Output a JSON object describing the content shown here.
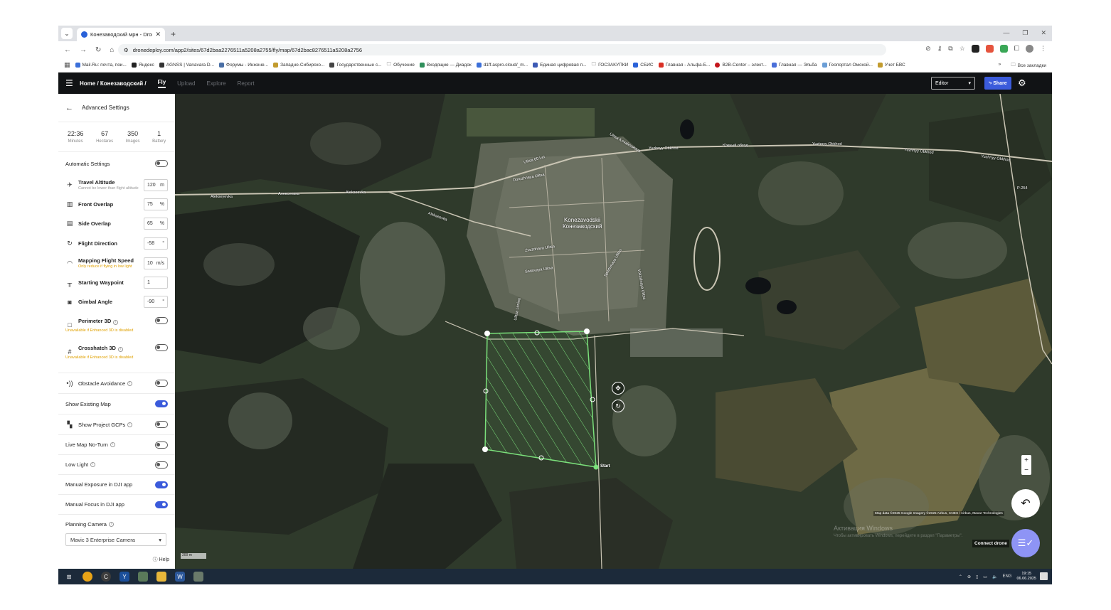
{
  "browser": {
    "tab_title": "Конезаводский мрн - DroneDeploy",
    "url": "dronedeploy.com/app2/sites/67d2baa2276511a5208a2755/fly/map/67d2bac8276511a5208a2756",
    "bookmarks": [
      "Mail.Ru: почта, пои...",
      "Яндекс",
      "AGNSS | Vanavara D...",
      "Форумы - Инжене...",
      "Западно-Сибирско...",
      "Государственные с...",
      "Обучение",
      "Входящие — Диадок",
      "d1ff.aspro.cloud/_m...",
      "Единая цифровая п...",
      "ГОСЗАКУПКИ",
      "СБИС",
      "Главная - Альфа-Б...",
      "B2B-Center – элект...",
      "Главная — Эльба",
      "Геопортал Омской...",
      "Учет БВС"
    ],
    "bookmarks_more": "»",
    "all_bookmarks": "Все закладки"
  },
  "appbar": {
    "breadcrumb": "Home / Конезаводский /",
    "tabs": [
      "Fly",
      "Upload",
      "Explore",
      "Report"
    ],
    "role": "Editor",
    "share_label": "Share"
  },
  "sidebar": {
    "title": "Advanced Settings",
    "stats": [
      {
        "value": "22:36",
        "label": "Minutes"
      },
      {
        "value": "67",
        "label": "Hectares"
      },
      {
        "value": "350",
        "label": "Images"
      },
      {
        "value": "1",
        "label": "Battery"
      }
    ],
    "automatic_settings": "Automatic Settings",
    "travel_altitude": {
      "label": "Travel Altitude",
      "hint": "Cannot be lower than flight altitude",
      "value": "120",
      "unit": "m"
    },
    "front_overlap": {
      "label": "Front Overlap",
      "value": "75",
      "unit": "%"
    },
    "side_overlap": {
      "label": "Side Overlap",
      "value": "65",
      "unit": "%"
    },
    "flight_direction": {
      "label": "Flight Direction",
      "value": "-58",
      "unit": "°"
    },
    "mapping_speed": {
      "label": "Mapping Flight Speed",
      "hint": "Only reduce if flying in low light",
      "value": "10",
      "unit": "m/s"
    },
    "starting_waypoint": {
      "label": "Starting Waypoint",
      "value": "1"
    },
    "gimbal_angle": {
      "label": "Gimbal Angle",
      "value": "-90",
      "unit": "°"
    },
    "perimeter_3d": {
      "label": "Perimeter 3D",
      "warn": "Unavailable if Enhanced 3D is disabled"
    },
    "crosshatch_3d": {
      "label": "Crosshatch 3D",
      "warn": "Unavailable if Enhanced 3D is disabled"
    },
    "obstacle_avoidance": "Obstacle Avoidance",
    "show_existing_map": "Show Existing Map",
    "show_project_gcps": "Show Project GCPs",
    "live_map_no_turn": "Live Map No-Turn",
    "low_light": "Low Light",
    "manual_exposure": "Manual Exposure in DJI app",
    "manual_focus": "Manual Focus in DJI app",
    "planning_camera": "Planning Camera",
    "camera_value": "Mavic 3 Enterprise Camera",
    "help": "Help"
  },
  "map": {
    "town_latin": "Konezavodskii",
    "town_cyrillic": "Конезаводский",
    "labels": [
      "Alekseyevka",
      "Алексеевка",
      "Alekseevka",
      "Alekseevka",
      "Yuzhnyy Obkhod",
      "Южный обход",
      "Yuzhnyy Obkhod",
      "Yuzhnyy Obkhod",
      "Yuzhnyy Obkhod",
      "Ulitsa 60 Let",
      "Dorozhnaya Ulitsa",
      "Ulitsa Kovalevskaya",
      "Zvezdnaya Ulitsa",
      "Sadovaya Ulitsa",
      "Sportivnaya Ulitsa",
      "Ulitsa Lenina",
      "Vokzalnaya Ulitsa",
      "P-254"
    ],
    "start_label": "Start",
    "scale_label": "200 m",
    "attribution": "Map data ©2025 Google Imagery ©2025 Airbus, CNES / Airbus, Maxar Technologies",
    "windows_activation": "Активация Windows",
    "windows_activation_sub": "Чтобы активировать Windows, перейдите в раздел \"Параметры\".",
    "connect_drone": "Connect drone"
  },
  "taskbar": {
    "lang": "ENG",
    "time": "19:15",
    "date": "06.06.2025"
  },
  "colors": {
    "accent": "#3b5bdb",
    "polygon": "#7be07b",
    "warning": "#e0a100"
  }
}
